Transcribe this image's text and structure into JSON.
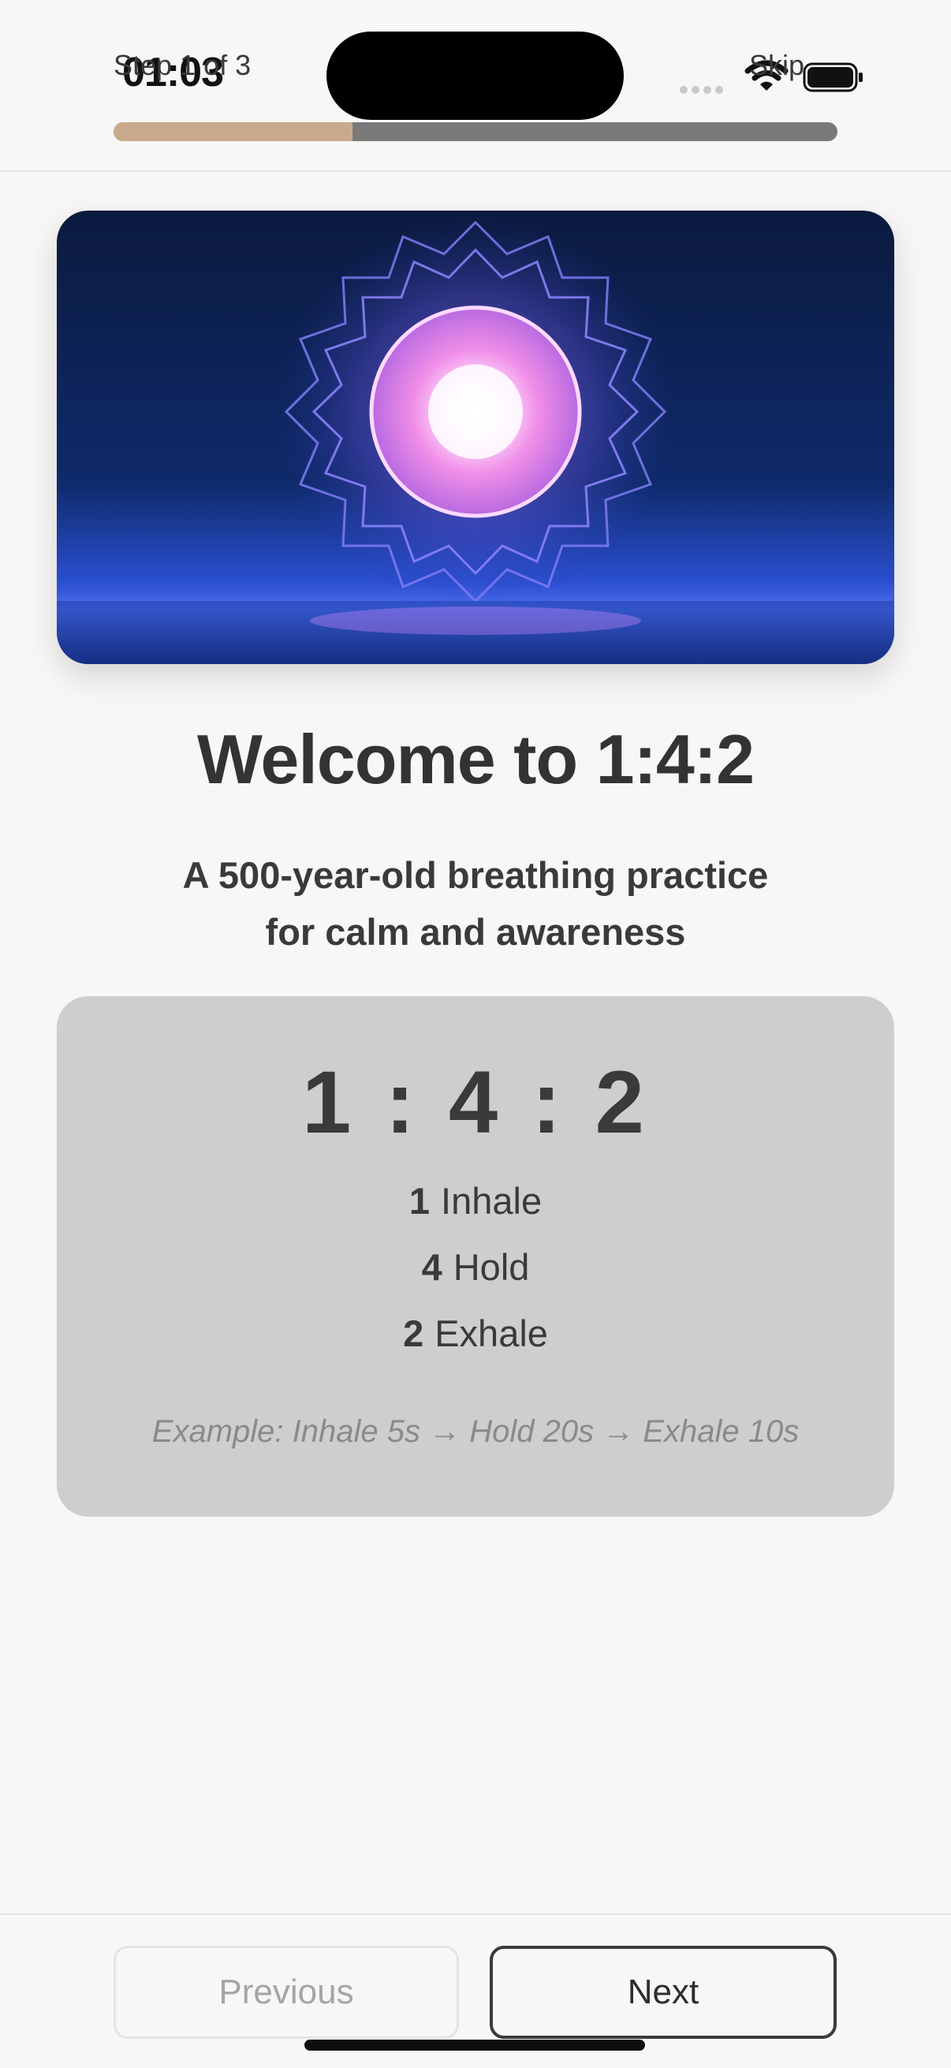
{
  "status_bar": {
    "time": "01:03",
    "icons": [
      "signal-dots-icon",
      "wifi-icon",
      "battery-icon"
    ]
  },
  "onboarding": {
    "step_label": "Step 1 of 3",
    "skip_label": "Skip",
    "progress": 0.33
  },
  "hero": {
    "image": "glowing-mandala-over-water"
  },
  "welcome": {
    "title": "Welcome to 1:4:2",
    "subtitle_line1": "A 500-year-old breathing practice",
    "subtitle_line2": "for calm and awareness"
  },
  "ratio_card": {
    "ratio": "1 : 4 : 2",
    "rows": [
      {
        "number": "1",
        "label": "Inhale"
      },
      {
        "number": "4",
        "label": "Hold"
      },
      {
        "number": "2",
        "label": "Exhale"
      }
    ],
    "example": "Example: Inhale 5s → Hold 20s → Exhale 10s"
  },
  "navigation": {
    "previous_label": "Previous",
    "next_label": "Next"
  },
  "colors": {
    "background": "#f8f7f5",
    "progress_fill": "#c9a98b",
    "progress_track": "#7a7a7a",
    "card": "#cfcecc",
    "text": "#3a3a3a"
  }
}
